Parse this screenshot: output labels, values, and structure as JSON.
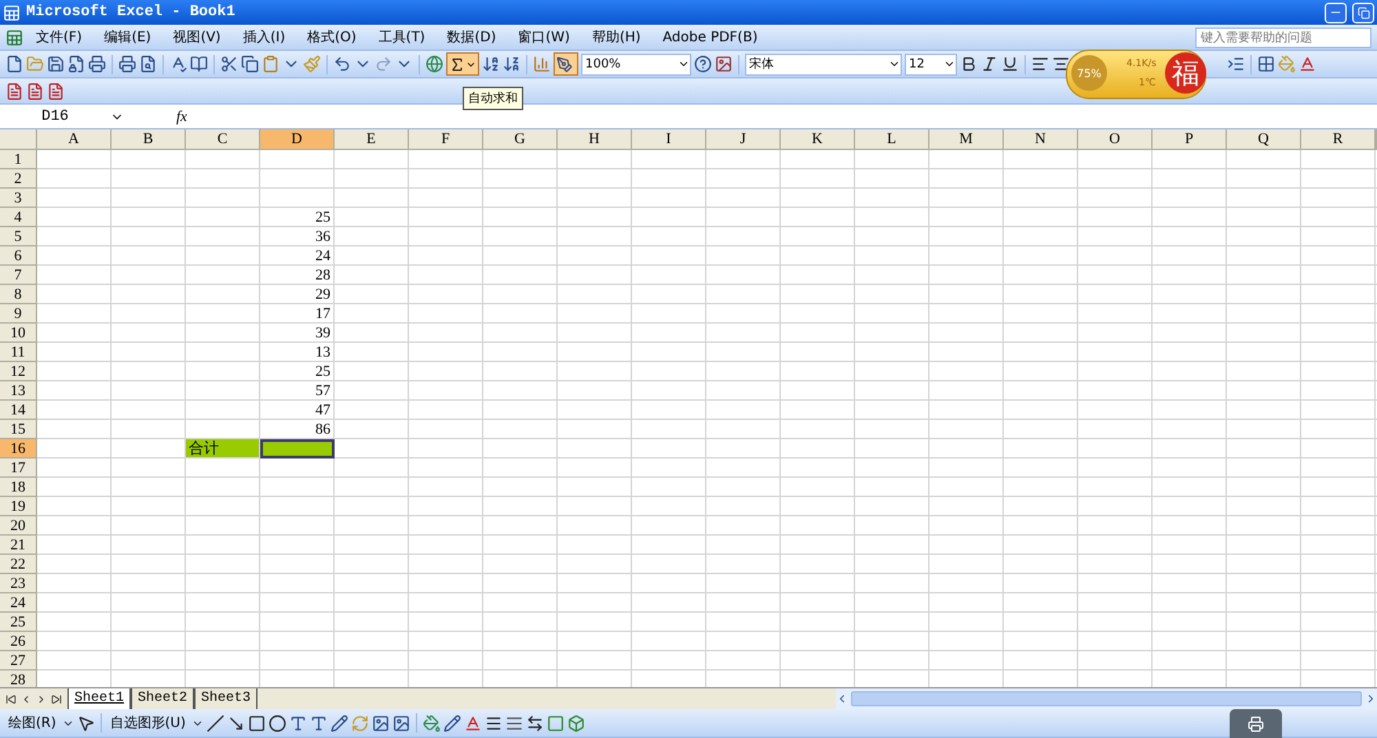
{
  "window": {
    "title": "Microsoft Excel - Book1"
  },
  "menu": {
    "items": [
      "文件(F)",
      "编辑(E)",
      "视图(V)",
      "插入(I)",
      "格式(O)",
      "工具(T)",
      "数据(D)",
      "窗口(W)",
      "帮助(H)",
      "Adobe PDF(B)"
    ],
    "help_box": {
      "placeholder": "键入需要帮助的问题"
    }
  },
  "standard_toolbar": {
    "zoom": "100%",
    "tooltip": "自动求和"
  },
  "formatting_toolbar": {
    "font": "宋体",
    "size": "12"
  },
  "widget": {
    "cpu": "75%",
    "speed": "4.1K/s",
    "temperature": "1℃",
    "badge": "福"
  },
  "formula_bar": {
    "name_box": "D16",
    "function_label": "fx"
  },
  "columns": [
    {
      "label": "A",
      "selected": false
    },
    {
      "label": "B",
      "selected": false
    },
    {
      "label": "C",
      "selected": false
    },
    {
      "label": "D",
      "selected": true
    },
    {
      "label": "E",
      "selected": false
    },
    {
      "label": "F",
      "selected": false
    },
    {
      "label": "G",
      "selected": false
    },
    {
      "label": "H",
      "selected": false
    },
    {
      "label": "I",
      "selected": false
    },
    {
      "label": "J",
      "selected": false
    },
    {
      "label": "K",
      "selected": false
    },
    {
      "label": "L",
      "selected": false
    },
    {
      "label": "M",
      "selected": false
    },
    {
      "label": "N",
      "selected": false
    },
    {
      "label": "O",
      "selected": false
    },
    {
      "label": "P",
      "selected": false
    },
    {
      "label": "Q",
      "selected": false
    },
    {
      "label": "R",
      "selected": false
    }
  ],
  "rows": [
    {
      "label": "1",
      "selected": false
    },
    {
      "label": "2",
      "selected": false
    },
    {
      "label": "3",
      "selected": false
    },
    {
      "label": "4",
      "selected": false,
      "cells": {
        "D": {
          "text": "25"
        }
      }
    },
    {
      "label": "5",
      "selected": false,
      "cells": {
        "D": {
          "text": "36"
        }
      }
    },
    {
      "label": "6",
      "selected": false,
      "cells": {
        "D": {
          "text": "24"
        }
      }
    },
    {
      "label": "7",
      "selected": false,
      "cells": {
        "D": {
          "text": "28"
        }
      }
    },
    {
      "label": "8",
      "selected": false,
      "cells": {
        "D": {
          "text": "29"
        }
      }
    },
    {
      "label": "9",
      "selected": false,
      "cells": {
        "D": {
          "text": "17"
        }
      }
    },
    {
      "label": "10",
      "selected": false,
      "cells": {
        "D": {
          "text": "39"
        }
      }
    },
    {
      "label": "11",
      "selected": false,
      "cells": {
        "D": {
          "text": "13"
        }
      }
    },
    {
      "label": "12",
      "selected": false,
      "cells": {
        "D": {
          "text": "25"
        }
      }
    },
    {
      "label": "13",
      "selected": false,
      "cells": {
        "D": {
          "text": "57"
        }
      }
    },
    {
      "label": "14",
      "selected": false,
      "cells": {
        "D": {
          "text": "47"
        }
      }
    },
    {
      "label": "15",
      "selected": false,
      "cells": {
        "D": {
          "text": "86"
        }
      }
    },
    {
      "label": "16",
      "selected": true,
      "cells": {
        "C": {
          "text": "合计",
          "color": "#99cc00",
          "selected": false
        },
        "D": {
          "color": "#99cc00",
          "selected": true
        }
      }
    },
    {
      "label": "17",
      "selected": false
    },
    {
      "label": "18",
      "selected": false
    },
    {
      "label": "19",
      "selected": false
    },
    {
      "label": "20",
      "selected": false
    },
    {
      "label": "21",
      "selected": false
    },
    {
      "label": "22",
      "selected": false
    },
    {
      "label": "23",
      "selected": false
    },
    {
      "label": "24",
      "selected": false
    },
    {
      "label": "25",
      "selected": false
    },
    {
      "label": "26",
      "selected": false
    },
    {
      "label": "27",
      "selected": false
    },
    {
      "label": "28",
      "selected": false
    }
  ],
  "sheet_tabs": [
    {
      "label": "Sheet1",
      "selected": true
    },
    {
      "label": "Sheet2",
      "selected": false
    },
    {
      "label": "Sheet3",
      "selected": false
    }
  ],
  "drawing_toolbar": {
    "draw_menu": "绘图(R)",
    "autoshapes_menu": "自选图形(U)"
  }
}
